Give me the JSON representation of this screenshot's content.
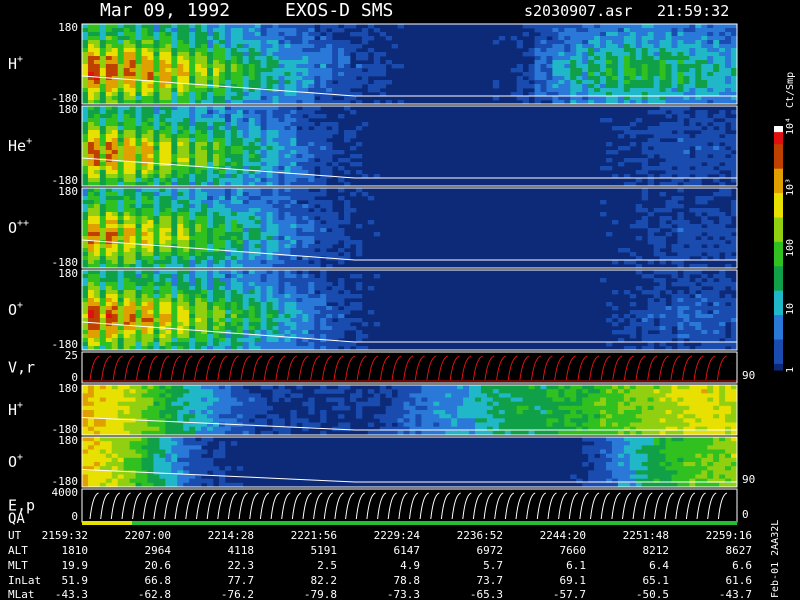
{
  "header": {
    "date": "Mar 09, 1992",
    "instrument": "EXOS-D SMS",
    "file": "s2030907.asr",
    "time": "21:59:32"
  },
  "colors": {
    "background": "#000000",
    "foreground": "#ffffff",
    "spectrum_bg": "#0c2a78",
    "ql_bar_yellow": "#e8e000",
    "ql_bar_green": "#22c030",
    "velocity_red": "#e01010"
  },
  "colorbar": {
    "units_label": "Ct/Smp",
    "tick_labels": [
      "1",
      "10",
      "100",
      "10³",
      "10⁴"
    ],
    "range": [
      1,
      10000
    ],
    "scale": "log"
  },
  "side_label": "Feb-01 2AA32L",
  "ephemeris": {
    "labels": [
      "UT",
      "ALT",
      "MLT",
      "InLat",
      "MLat"
    ],
    "UT": [
      "2159:32",
      "2207:00",
      "2214:28",
      "2221:56",
      "2229:24",
      "2236:52",
      "2244:20",
      "2251:48",
      "2259:16"
    ],
    "ALT": [
      "1810",
      "2964",
      "4118",
      "5191",
      "6147",
      "6972",
      "7660",
      "8212",
      "8627"
    ],
    "MLT": [
      "19.9",
      "20.6",
      "22.3",
      "2.5",
      "4.9",
      "5.7",
      "6.1",
      "6.4",
      "6.6"
    ],
    "InLat": [
      "51.9",
      "66.8",
      "77.7",
      "82.2",
      "78.8",
      "73.7",
      "69.1",
      "65.1",
      "61.6"
    ],
    "MLat": [
      "-43.3",
      "-62.8",
      "-76.2",
      "-79.8",
      "-73.3",
      "-65.3",
      "-57.7",
      "-50.5",
      "-43.7"
    ]
  },
  "chart_data": [
    {
      "type": "heatmap",
      "panel": "H+ angle spectrogram",
      "ylabel": "H",
      "ylabel_sup": "+",
      "ylim": [
        -180,
        180
      ],
      "y_tick_labels": [
        "180",
        "-180"
      ],
      "profile": [
        1.0,
        0.95,
        0.9,
        0.85,
        0.75,
        0.62,
        0.5,
        0.4,
        0.3,
        0.2,
        0.12,
        0.05,
        0.0,
        0.0,
        0.0,
        0.0,
        0.05,
        0.2,
        0.35,
        0.45,
        0.5,
        0.5,
        0.45,
        0.4,
        0.35
      ]
    },
    {
      "type": "heatmap",
      "panel": "He+ angle spectrogram",
      "ylabel": "He",
      "ylabel_sup": "+",
      "ylim": [
        -180,
        180
      ],
      "y_tick_labels": [
        "180",
        "-180"
      ],
      "profile": [
        0.95,
        0.9,
        0.82,
        0.75,
        0.65,
        0.55,
        0.45,
        0.35,
        0.22,
        0.1,
        0.03,
        0.0,
        0.0,
        0.0,
        0.0,
        0.0,
        0.0,
        0.0,
        0.0,
        0.0,
        0.05,
        0.1,
        0.12,
        0.12,
        0.1
      ]
    },
    {
      "type": "heatmap",
      "panel": "O++ angle spectrogram",
      "ylabel": "O",
      "ylabel_sup": "++",
      "ylim": [
        -180,
        180
      ],
      "y_tick_labels": [
        "180",
        "-180"
      ],
      "profile": [
        0.9,
        0.88,
        0.8,
        0.72,
        0.62,
        0.52,
        0.42,
        0.32,
        0.2,
        0.1,
        0.03,
        0.0,
        0.0,
        0.0,
        0.0,
        0.0,
        0.0,
        0.0,
        0.0,
        0.0,
        0.03,
        0.08,
        0.1,
        0.1,
        0.08
      ]
    },
    {
      "type": "heatmap",
      "panel": "O+ angle spectrogram",
      "ylabel": "O",
      "ylabel_sup": "+",
      "ylim": [
        -180,
        180
      ],
      "y_tick_labels": [
        "180",
        "-180"
      ],
      "profile": [
        1.0,
        0.95,
        0.88,
        0.8,
        0.7,
        0.6,
        0.5,
        0.4,
        0.28,
        0.15,
        0.05,
        0.0,
        0.0,
        0.0,
        0.0,
        0.0,
        0.0,
        0.0,
        0.0,
        0.0,
        0.05,
        0.12,
        0.15,
        0.15,
        0.12
      ]
    },
    {
      "type": "line",
      "panel": "V, r",
      "ylabel": "V,r",
      "ylim": [
        0,
        25
      ],
      "y_tick_labels": [
        "25",
        "0"
      ],
      "right_tick_label": "90",
      "sweep_count": 55
    },
    {
      "type": "heatmap",
      "panel": "H+ energy spectrogram",
      "ylabel": "H",
      "ylabel_sup": "+",
      "ylim": [
        -180,
        180
      ],
      "y_tick_labels": [
        "180",
        "-180"
      ],
      "profile": [
        0.75,
        0.7,
        0.6,
        0.45,
        0.3,
        0.2,
        0.1,
        0.05,
        0.05,
        0.05,
        0.05,
        0.05,
        0.15,
        0.2,
        0.25,
        0.35,
        0.4,
        0.4,
        0.45,
        0.5,
        0.55,
        0.6,
        0.65,
        0.7,
        0.65
      ]
    },
    {
      "type": "heatmap",
      "panel": "O+ energy spectrogram",
      "ylabel": "O",
      "ylabel_sup": "+",
      "ylim": [
        -180,
        180
      ],
      "y_tick_labels": [
        "180",
        "-180"
      ],
      "right_tick_label": "90",
      "profile": [
        0.75,
        0.65,
        0.5,
        0.3,
        0.12,
        0.05,
        0.0,
        0.0,
        0.0,
        0.0,
        0.0,
        0.0,
        0.0,
        0.0,
        0.0,
        0.0,
        0.0,
        0.0,
        0.0,
        0.1,
        0.25,
        0.4,
        0.5,
        0.55,
        0.6
      ]
    },
    {
      "type": "line",
      "panel": "E, p",
      "ylabel": "E,p",
      "ylabel_bottom": "QA",
      "ylim": [
        0,
        4000
      ],
      "y_tick_labels": [
        "4000",
        "0"
      ],
      "right_tick_label": "0",
      "sweep_count": 60
    }
  ]
}
